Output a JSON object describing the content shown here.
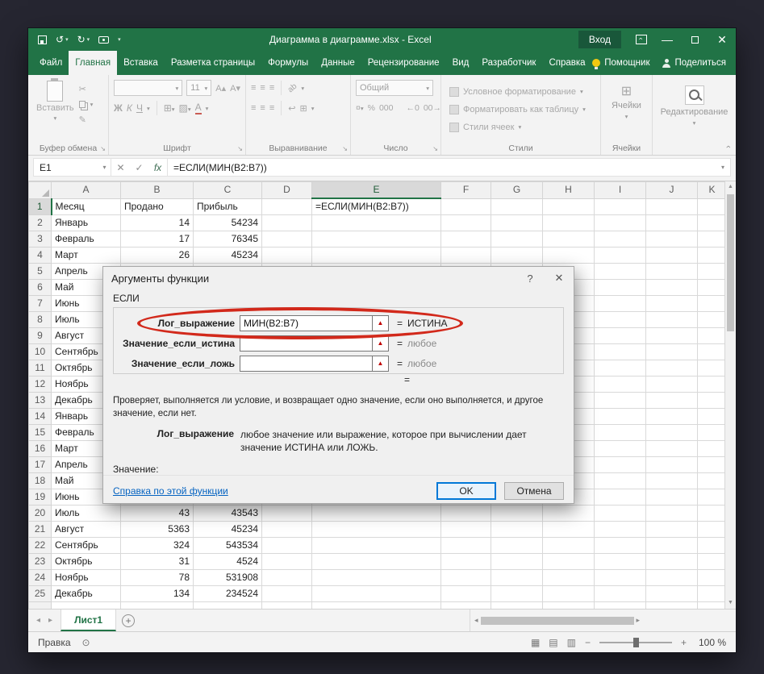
{
  "window": {
    "title": "Диаграмма в диаграмме.xlsx  -  Excel",
    "signin": "Вход"
  },
  "ribbon": {
    "file_tab": "Файл",
    "tabs": [
      "Главная",
      "Вставка",
      "Разметка страницы",
      "Формулы",
      "Данные",
      "Рецензирование",
      "Вид",
      "Разработчик",
      "Справка"
    ],
    "active_tab": "Главная",
    "assistant": "Помощник",
    "share": "Поделиться",
    "paste": "Вставить",
    "clipboard_group": "Буфер обмена",
    "font_group": "Шрифт",
    "font_size": "11",
    "bold": "Ж",
    "italic": "К",
    "underline": "Ч",
    "align_group": "Выравнивание",
    "number_group": "Число",
    "number_format": "Общий",
    "styles_group": "Стили",
    "style_buttons": [
      "Условное форматирование",
      "Форматировать как таблицу",
      "Стили ячеек"
    ],
    "cells": "Ячейки",
    "editing": "Редактирование"
  },
  "formula_bar": {
    "name_box": "E1",
    "fx": "fx",
    "formula": "=ЕСЛИ(МИН(B2:B7))"
  },
  "grid": {
    "columns": [
      "A",
      "B",
      "C",
      "D",
      "E",
      "F",
      "G",
      "H",
      "I",
      "J",
      "K"
    ],
    "rows": [
      {
        "n": 1,
        "A": "Месяц",
        "B": "Продано",
        "C": "Прибыль",
        "E": "=ЕСЛИ(МИН(B2:B7))"
      },
      {
        "n": 2,
        "A": "Январь",
        "B": "14",
        "C": "54234"
      },
      {
        "n": 3,
        "A": "Февраль",
        "B": "17",
        "C": "76345"
      },
      {
        "n": 4,
        "A": "Март",
        "B": "26",
        "C": "45234"
      },
      {
        "n": 5,
        "A": "Апрель"
      },
      {
        "n": 6,
        "A": "Май"
      },
      {
        "n": 7,
        "A": "Июнь"
      },
      {
        "n": 8,
        "A": "Июль"
      },
      {
        "n": 9,
        "A": "Август"
      },
      {
        "n": 10,
        "A": "Сентябрь"
      },
      {
        "n": 11,
        "A": "Октябрь"
      },
      {
        "n": 12,
        "A": "Ноябрь"
      },
      {
        "n": 13,
        "A": "Декабрь"
      },
      {
        "n": 14,
        "A": "Январь"
      },
      {
        "n": 15,
        "A": "Февраль"
      },
      {
        "n": 16,
        "A": "Март"
      },
      {
        "n": 17,
        "A": "Апрель"
      },
      {
        "n": 18,
        "A": "Май"
      },
      {
        "n": 19,
        "A": "Июнь"
      },
      {
        "n": 20,
        "A": "Июль",
        "B": "43",
        "C": "43543"
      },
      {
        "n": 21,
        "A": "Август",
        "B": "5363",
        "C": "45234"
      },
      {
        "n": 22,
        "A": "Сентябрь",
        "B": "324",
        "C": "543534"
      },
      {
        "n": 23,
        "A": "Октябрь",
        "B": "31",
        "C": "4524"
      },
      {
        "n": 24,
        "A": "Ноябрь",
        "B": "78",
        "C": "531908"
      },
      {
        "n": 25,
        "A": "Декабрь",
        "B": "134",
        "C": "234524"
      }
    ]
  },
  "dialog": {
    "title": "Аргументы функции",
    "function_name": "ЕСЛИ",
    "args": [
      {
        "label": "Лог_выражение",
        "value": "МИН(B2:B7)",
        "result": "ИСТИНА"
      },
      {
        "label": "Значение_если_истина",
        "value": "",
        "result": "любое"
      },
      {
        "label": "Значение_если_ложь",
        "value": "",
        "result": "любое"
      }
    ],
    "equals": "=",
    "description": "Проверяет, выполняется ли условие, и возвращает одно значение, если оно выполняется, и другое значение, если нет.",
    "arg_help_label": "Лог_выражение",
    "arg_help_text": "любое значение или выражение, которое при вычислении дает значение ИСТИНА или ЛОЖЬ.",
    "value_label": "Значение:",
    "help_link": "Справка по этой функции",
    "ok": "OK",
    "cancel": "Отмена"
  },
  "sheet": {
    "tab": "Лист1",
    "status_mode": "Правка",
    "zoom": "100 %"
  }
}
